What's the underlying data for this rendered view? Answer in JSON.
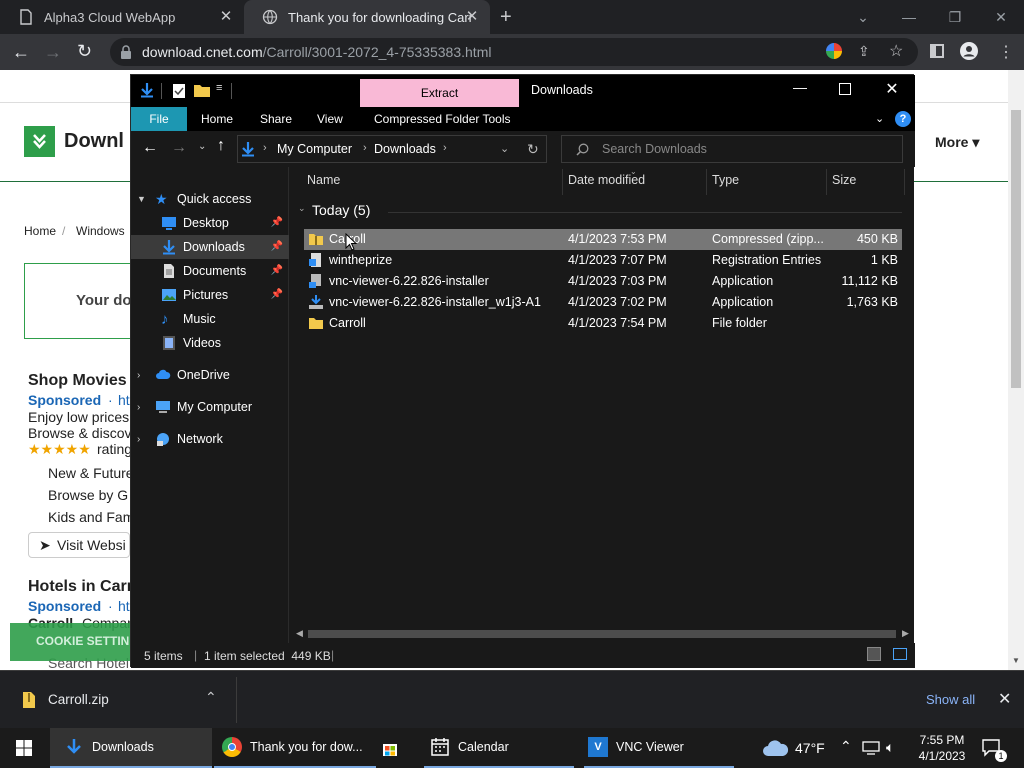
{
  "browser": {
    "tabs": [
      {
        "title": "Alpha3 Cloud WebApp",
        "active": false
      },
      {
        "title": "Thank you for downloading Carr",
        "active": true
      }
    ],
    "url_domain": "download.cnet.com",
    "url_path": "/Carroll/3001-2072_4-75335383.html",
    "new_tab": "+"
  },
  "website": {
    "logo_text": "Downl",
    "more_label": "More",
    "breadcrumb_home": "Home",
    "breadcrumb_sep": "/",
    "breadcrumb_windows": "Windows",
    "banner_text": "Your do",
    "shop_title": "Shop Movies",
    "sponsored": "Sponsored",
    "sponsored_url": "ht",
    "desc1": "Enjoy low prices",
    "desc2": "Browse & discov",
    "stars": "★★★★★",
    "rating": "rating",
    "link1": "New & Future",
    "link2": "Browse by G",
    "link3": "Kids and Fam",
    "visit_btn": "Visit Websi",
    "hotels_title": "Hotels in Carr",
    "sponsored2": "Sponsored",
    "sponsored2_url": "ht",
    "hotel_desc": "Carroll",
    "hotel_desc2": "Compar",
    "hotel_search": "Search Hotel",
    "cookie_btn": "COOKIE SETTIN"
  },
  "explorer": {
    "extract_tab": "Extract",
    "window_title": "Downloads",
    "ribbon_tabs": [
      "File",
      "Home",
      "Share",
      "View",
      "Compressed Folder Tools"
    ],
    "breadcrumb": [
      "My Computer",
      "Downloads"
    ],
    "search_placeholder": "Search Downloads",
    "nav_items": [
      {
        "label": "Quick access",
        "icon": "star-icon"
      },
      {
        "label": "Desktop",
        "icon": "desktop-icon"
      },
      {
        "label": "Downloads",
        "icon": "download-arrow-icon"
      },
      {
        "label": "Documents",
        "icon": "document-icon"
      },
      {
        "label": "Pictures",
        "icon": "pictures-icon"
      },
      {
        "label": "Music",
        "icon": "music-icon"
      },
      {
        "label": "Videos",
        "icon": "videos-icon"
      },
      {
        "label": "OneDrive",
        "icon": "cloud-icon"
      },
      {
        "label": "My Computer",
        "icon": "computer-icon"
      },
      {
        "label": "Network",
        "icon": "network-icon"
      }
    ],
    "columns": [
      "Name",
      "Date modified",
      "Type",
      "Size"
    ],
    "group_label": "Today (5)",
    "files": [
      {
        "name": "Carroll",
        "date": "4/1/2023 7:53 PM",
        "type": "Compressed (zipp...",
        "size": "450 KB",
        "icon": "zip-folder-icon"
      },
      {
        "name": "wintheprize",
        "date": "4/1/2023 7:07 PM",
        "type": "Registration Entries",
        "size": "1 KB",
        "icon": "registry-icon"
      },
      {
        "name": "vnc-viewer-6.22.826-installer",
        "date": "4/1/2023 7:03 PM",
        "type": "Application",
        "size": "11,112 KB",
        "icon": "installer-icon"
      },
      {
        "name": "vnc-viewer-6.22.826-installer_w1j3-A1",
        "date": "4/1/2023 7:02 PM",
        "type": "Application",
        "size": "1,763 KB",
        "icon": "installer-icon"
      },
      {
        "name": "Carroll",
        "date": "4/1/2023 7:54 PM",
        "type": "File folder",
        "size": "",
        "icon": "folder-icon"
      }
    ],
    "status_items": "5 items",
    "status_selected": "1 item selected  449 KB",
    "status_sep": "|"
  },
  "download_bar": {
    "file": "Carroll.zip",
    "show_all": "Show all"
  },
  "taskbar": {
    "items": [
      "Downloads",
      "Thank you for dow...",
      "Calendar",
      "VNC Viewer"
    ],
    "weather": "47°F",
    "time": "7:55 PM",
    "date": "4/1/2023",
    "notif_count": "1"
  }
}
